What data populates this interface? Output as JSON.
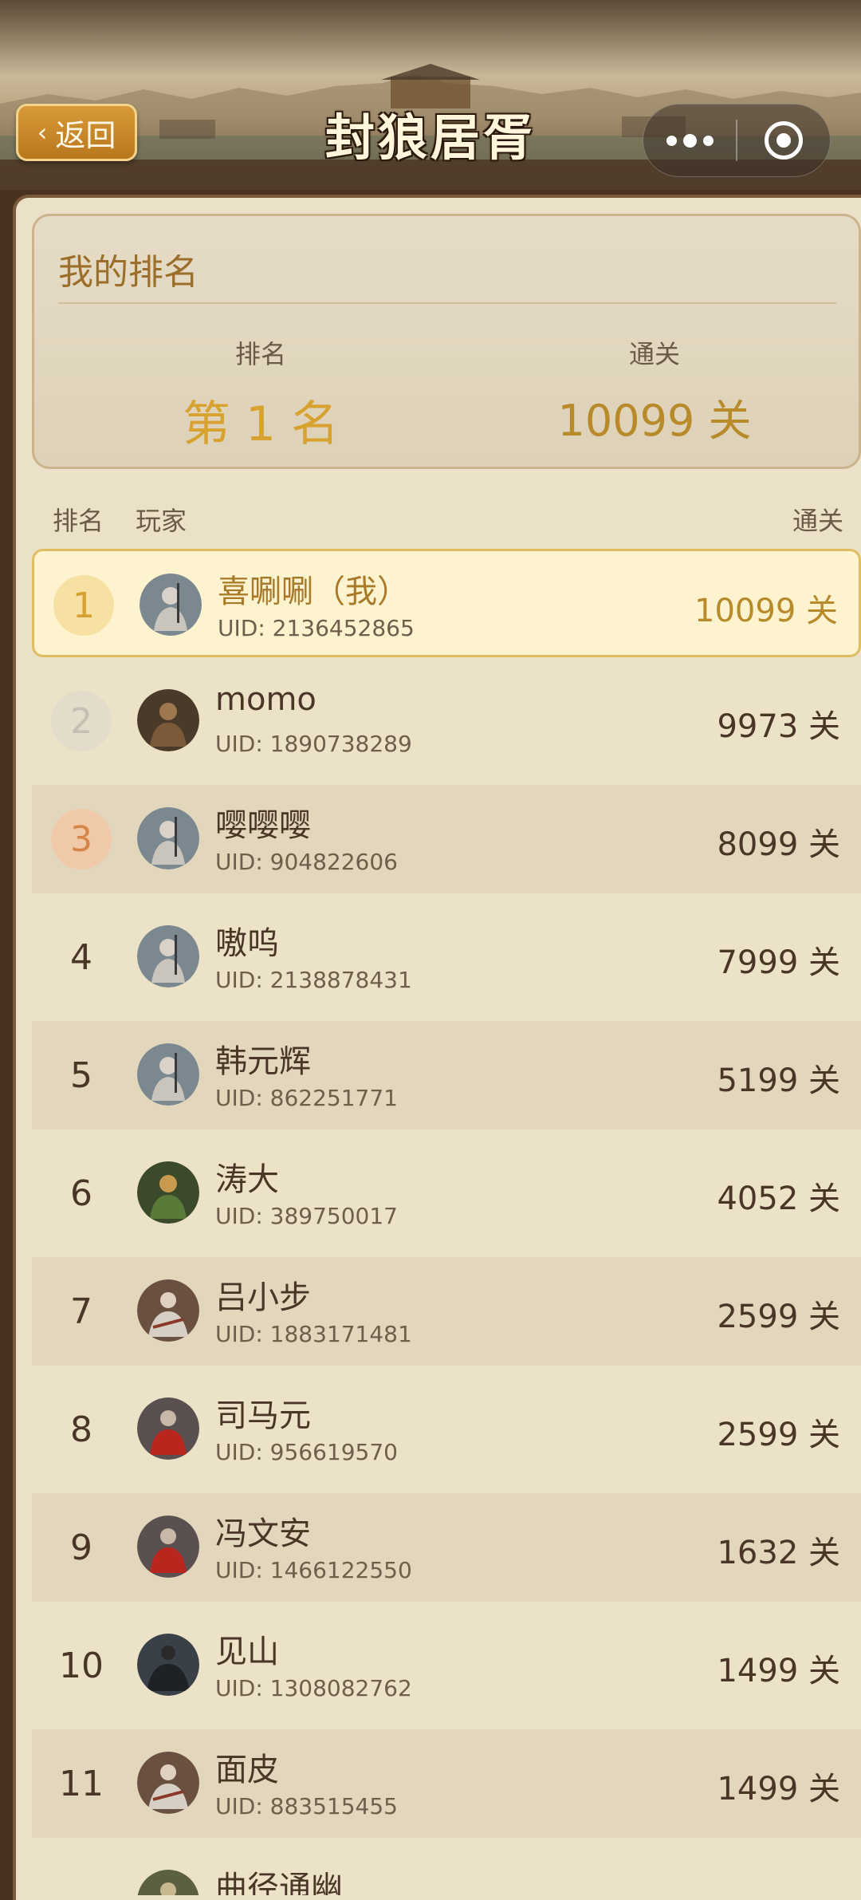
{
  "header": {
    "back_label": "返回",
    "title": "封狼居胥",
    "more_icon": "more-dots-icon",
    "close_icon": "target-circle-icon"
  },
  "my_rank": {
    "title": "我的排名",
    "rank_label": "排名",
    "rank_value": "第 1 名",
    "pass_label": "通关",
    "pass_value": "10099 关"
  },
  "list_header": {
    "rank": "排名",
    "player": "玩家",
    "pass": "通关"
  },
  "rows": [
    {
      "rank": "1",
      "name": "喜唰唰（我）",
      "uid": "UID: 2136452865",
      "score": "10099 关"
    },
    {
      "rank": "2",
      "name": "momo",
      "uid": "UID: 1890738289",
      "score": "9973 关"
    },
    {
      "rank": "3",
      "name": "嘤嘤嘤",
      "uid": "UID: 904822606",
      "score": "8099 关"
    },
    {
      "rank": "4",
      "name": "嗷呜",
      "uid": "UID: 2138878431",
      "score": "7999 关"
    },
    {
      "rank": "5",
      "name": "韩元辉",
      "uid": "UID: 862251771",
      "score": "5199 关"
    },
    {
      "rank": "6",
      "name": "涛大",
      "uid": "UID: 389750017",
      "score": "4052 关"
    },
    {
      "rank": "7",
      "name": "吕小步",
      "uid": "UID: 1883171481",
      "score": "2599 关"
    },
    {
      "rank": "8",
      "name": "司马元",
      "uid": "UID: 956619570",
      "score": "2599 关"
    },
    {
      "rank": "9",
      "name": "冯文安",
      "uid": "UID: 1466122550",
      "score": "1632 关"
    },
    {
      "rank": "10",
      "name": "见山",
      "uid": "UID: 1308082762",
      "score": "1499 关"
    },
    {
      "rank": "11",
      "name": "面皮",
      "uid": "UID: 883515455",
      "score": "1499 关"
    },
    {
      "rank": "",
      "name": "曲径通幽",
      "uid": "",
      "score": ""
    }
  ],
  "colors": {
    "gold": "#d6a034",
    "brown_text": "#4a3626",
    "highlight_bg": "#fdf3cf"
  }
}
